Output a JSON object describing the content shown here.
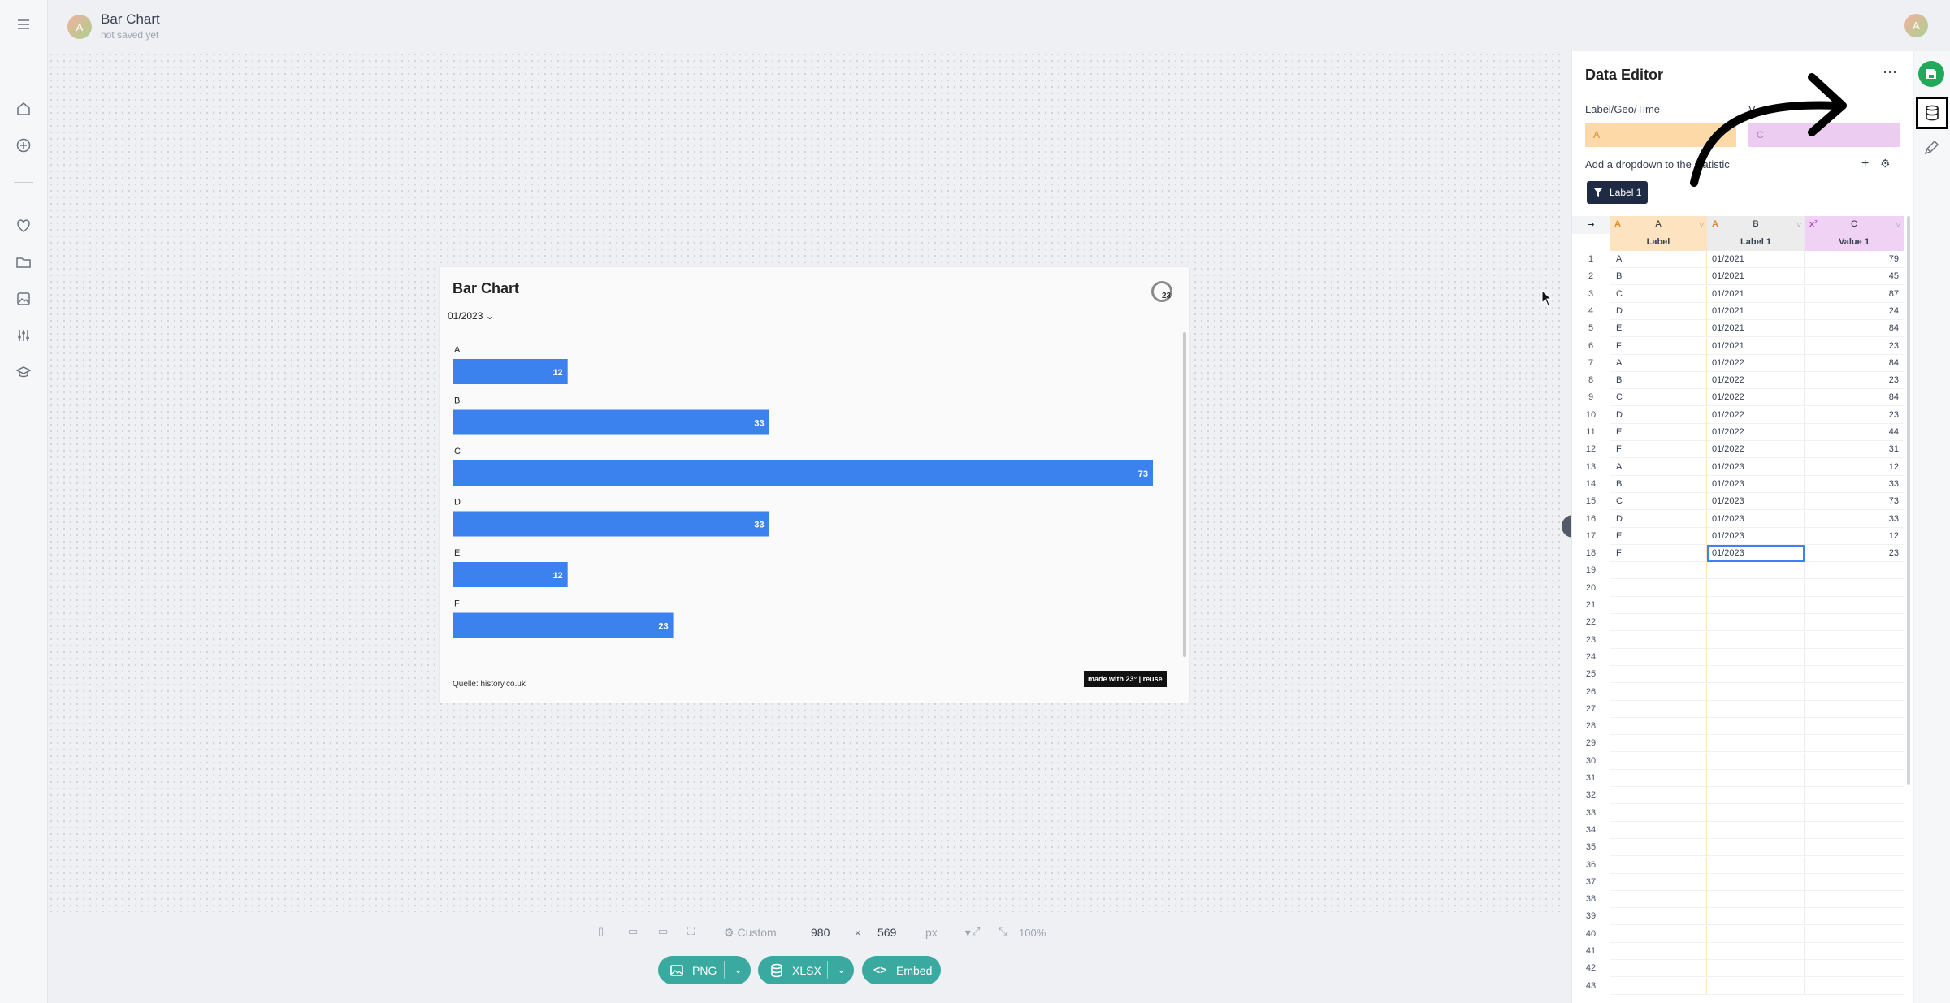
{
  "header": {
    "avatar_initial": "A",
    "title": "Bar Chart",
    "subtitle": "not saved yet",
    "user_initial": "A"
  },
  "chart": {
    "title": "Bar Chart",
    "dropdown_value": "01/2023",
    "source": "Quelle: history.co.uk",
    "badge": "made with 23° | reuse",
    "logo_text": "23"
  },
  "chart_data": {
    "type": "bar",
    "title": "Bar Chart",
    "categories": [
      "A",
      "B",
      "C",
      "D",
      "E",
      "F"
    ],
    "values": [
      12,
      33,
      73,
      33,
      12,
      23
    ],
    "xlabel": "",
    "ylabel": "",
    "orientation": "horizontal",
    "data_labels": true,
    "color": "#3b82ef",
    "grid": false
  },
  "toolbar": {
    "preset_label": "Custom",
    "width": "980",
    "height": "569",
    "times": "×",
    "unit": "px",
    "zoom": "100%",
    "png_label": "PNG",
    "xlsx_label": "XLSX",
    "embed_label": "Embed"
  },
  "editor": {
    "title": "Data Editor",
    "label_geo_time": "Label/Geo/Time",
    "value_label": "V",
    "field_a": "A",
    "field_c": "C",
    "dropdown_label": "Add a dropdown to the statistic",
    "chip_label": "Label 1",
    "columns": [
      "A",
      "B",
      "C"
    ],
    "col_a_type": "A",
    "col_b_type": "A",
    "col_c_type": "x²",
    "headers": [
      "Label",
      "Label 1",
      "Value 1"
    ],
    "rows": [
      [
        "A",
        "01/2021",
        "79"
      ],
      [
        "B",
        "01/2021",
        "45"
      ],
      [
        "C",
        "01/2021",
        "87"
      ],
      [
        "D",
        "01/2021",
        "24"
      ],
      [
        "E",
        "01/2021",
        "84"
      ],
      [
        "F",
        "01/2021",
        "23"
      ],
      [
        "A",
        "01/2022",
        "84"
      ],
      [
        "B",
        "01/2022",
        "23"
      ],
      [
        "C",
        "01/2022",
        "84"
      ],
      [
        "D",
        "01/2022",
        "23"
      ],
      [
        "E",
        "01/2022",
        "44"
      ],
      [
        "F",
        "01/2022",
        "31"
      ],
      [
        "A",
        "01/2023",
        "12"
      ],
      [
        "B",
        "01/2023",
        "33"
      ],
      [
        "C",
        "01/2023",
        "73"
      ],
      [
        "D",
        "01/2023",
        "33"
      ],
      [
        "E",
        "01/2023",
        "12"
      ],
      [
        "F",
        "01/2023",
        "23"
      ]
    ],
    "row_count": 43
  }
}
